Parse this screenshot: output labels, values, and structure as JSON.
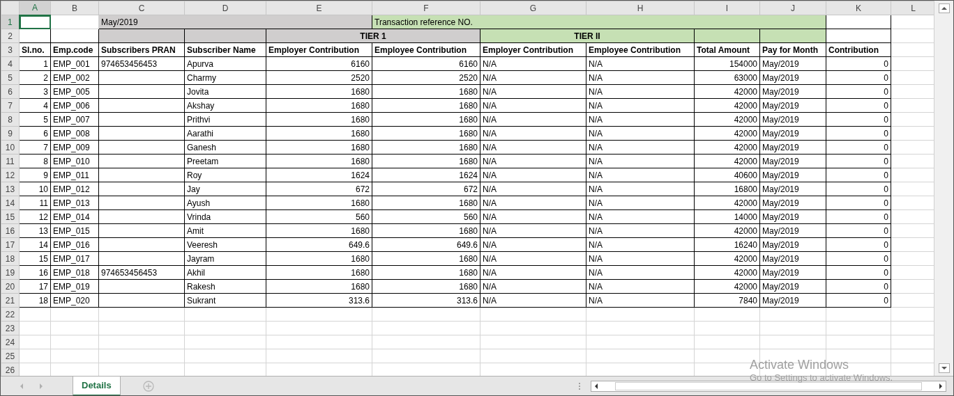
{
  "columns": [
    {
      "label": "A",
      "selected": true
    },
    {
      "label": "B",
      "selected": false
    },
    {
      "label": "C",
      "selected": false
    },
    {
      "label": "D",
      "selected": false
    },
    {
      "label": "E",
      "selected": false
    },
    {
      "label": "F",
      "selected": false
    },
    {
      "label": "G",
      "selected": false
    },
    {
      "label": "H",
      "selected": false
    },
    {
      "label": "I",
      "selected": false
    },
    {
      "label": "J",
      "selected": false
    },
    {
      "label": "K",
      "selected": false
    },
    {
      "label": "L",
      "selected": false
    }
  ],
  "row_numbers": [
    {
      "label": "1",
      "selected": true
    },
    {
      "label": "2",
      "selected": false
    },
    {
      "label": "3",
      "selected": false
    },
    {
      "label": "4",
      "selected": false
    },
    {
      "label": "5",
      "selected": false
    },
    {
      "label": "6",
      "selected": false
    },
    {
      "label": "7",
      "selected": false
    },
    {
      "label": "8",
      "selected": false
    },
    {
      "label": "9",
      "selected": false
    },
    {
      "label": "10",
      "selected": false
    },
    {
      "label": "11",
      "selected": false
    },
    {
      "label": "12",
      "selected": false
    },
    {
      "label": "13",
      "selected": false
    },
    {
      "label": "14",
      "selected": false
    },
    {
      "label": "15",
      "selected": false
    },
    {
      "label": "16",
      "selected": false
    },
    {
      "label": "17",
      "selected": false
    },
    {
      "label": "18",
      "selected": false
    },
    {
      "label": "19",
      "selected": false
    },
    {
      "label": "20",
      "selected": false
    },
    {
      "label": "21",
      "selected": false
    },
    {
      "label": "22",
      "selected": false
    },
    {
      "label": "23",
      "selected": false
    },
    {
      "label": "24",
      "selected": false
    },
    {
      "label": "25",
      "selected": false
    },
    {
      "label": "26",
      "selected": false
    }
  ],
  "header_band": {
    "date": "May/2019",
    "reference_label": "Transaction reference NO."
  },
  "tiers": [
    "TIER 1",
    "TIER II"
  ],
  "column_headers": [
    "Sl.no.",
    "Emp.code",
    "Subscribers PRAN",
    "Subscriber Name",
    "Employer Contribution",
    "Employee Contribution",
    "Employer Contribution",
    "Employee Contribution",
    "Total Amount",
    "Pay for Month",
    "Contribution"
  ],
  "rows": [
    {
      "sl": "1",
      "emp_code": "EMP_001",
      "pran": "974653456453",
      "name": "Apurva",
      "employer": "6160",
      "employee": "6160",
      "tier2_employer": "N/A",
      "tier2_employee": "N/A",
      "total": "154000",
      "month": "May/2019",
      "contribution": "0"
    },
    {
      "sl": "2",
      "emp_code": "EMP_002",
      "name": "Charmy",
      "employer": "2520",
      "employee": "2520",
      "tier2_employer": "N/A",
      "tier2_employee": "N/A",
      "total": "63000",
      "month": "May/2019",
      "contribution": "0"
    },
    {
      "sl": "3",
      "emp_code": "EMP_005",
      "name": "Jovita",
      "employer": "1680",
      "employee": "1680",
      "tier2_employer": "N/A",
      "tier2_employee": "N/A",
      "total": "42000",
      "month": "May/2019",
      "contribution": "0"
    },
    {
      "sl": "4",
      "emp_code": "EMP_006",
      "name": "Akshay",
      "employer": "1680",
      "employee": "1680",
      "tier2_employer": "N/A",
      "tier2_employee": "N/A",
      "total": "42000",
      "month": "May/2019",
      "contribution": "0"
    },
    {
      "sl": "5",
      "emp_code": "EMP_007",
      "name": "Prithvi",
      "employer": "1680",
      "employee": "1680",
      "tier2_employer": "N/A",
      "tier2_employee": "N/A",
      "total": "42000",
      "month": "May/2019",
      "contribution": "0"
    },
    {
      "sl": "6",
      "emp_code": "EMP_008",
      "name": "Aarathi",
      "employer": "1680",
      "employee": "1680",
      "tier2_employer": "N/A",
      "tier2_employee": "N/A",
      "total": "42000",
      "month": "May/2019",
      "contribution": "0"
    },
    {
      "sl": "7",
      "emp_code": "EMP_009",
      "name": "Ganesh",
      "employer": "1680",
      "employee": "1680",
      "tier2_employer": "N/A",
      "tier2_employee": "N/A",
      "total": "42000",
      "month": "May/2019",
      "contribution": "0"
    },
    {
      "sl": "8",
      "emp_code": "EMP_010",
      "name": "Preetam",
      "employer": "1680",
      "employee": "1680",
      "tier2_employer": "N/A",
      "tier2_employee": "N/A",
      "total": "42000",
      "month": "May/2019",
      "contribution": "0"
    },
    {
      "sl": "9",
      "emp_code": "EMP_011",
      "name": "Roy",
      "employer": "1624",
      "employee": "1624",
      "tier2_employer": "N/A",
      "tier2_employee": "N/A",
      "total": "40600",
      "month": "May/2019",
      "contribution": "0"
    },
    {
      "sl": "10",
      "emp_code": "EMP_012",
      "name": "Jay",
      "employer": "672",
      "employee": "672",
      "tier2_employer": "N/A",
      "tier2_employee": "N/A",
      "total": "16800",
      "month": "May/2019",
      "contribution": "0"
    },
    {
      "sl": "11",
      "emp_code": "EMP_013",
      "name": "Ayush",
      "employer": "1680",
      "employee": "1680",
      "tier2_employer": "N/A",
      "tier2_employee": "N/A",
      "total": "42000",
      "month": "May/2019",
      "contribution": "0"
    },
    {
      "sl": "12",
      "emp_code": "EMP_014",
      "name": "Vrinda",
      "employer": "560",
      "employee": "560",
      "tier2_employer": "N/A",
      "tier2_employee": "N/A",
      "total": "14000",
      "month": "May/2019",
      "contribution": "0"
    },
    {
      "sl": "13",
      "emp_code": "EMP_015",
      "name": "Amit",
      "employer": "1680",
      "employee": "1680",
      "tier2_employer": "N/A",
      "tier2_employee": "N/A",
      "total": "42000",
      "month": "May/2019",
      "contribution": "0"
    },
    {
      "sl": "14",
      "emp_code": "EMP_016",
      "name": "Veeresh",
      "employer": "649.6",
      "employee": "649.6",
      "tier2_employer": "N/A",
      "tier2_employee": "N/A",
      "total": "16240",
      "month": "May/2019",
      "contribution": "0"
    },
    {
      "sl": "15",
      "emp_code": "EMP_017",
      "name": "Jayram",
      "employer": "1680",
      "employee": "1680",
      "tier2_employer": "N/A",
      "tier2_employee": "N/A",
      "total": "42000",
      "month": "May/2019",
      "contribution": "0"
    },
    {
      "sl": "16",
      "emp_code": "EMP_018",
      "pran": "974653456453",
      "name": "Akhil",
      "employer": "1680",
      "employee": "1680",
      "tier2_employer": "N/A",
      "tier2_employee": "N/A",
      "total": "42000",
      "month": "May/2019",
      "contribution": "0"
    },
    {
      "sl": "17",
      "emp_code": "EMP_019",
      "name": "Rakesh",
      "employer": "1680",
      "employee": "1680",
      "tier2_employer": "N/A",
      "tier2_employee": "N/A",
      "total": "42000",
      "month": "May/2019",
      "contribution": "0"
    },
    {
      "sl": "18",
      "emp_code": "EMP_020",
      "name": "Sukrant",
      "employer": "313.6",
      "employee": "313.6",
      "tier2_employer": "N/A",
      "tier2_employee": "N/A",
      "total": "7840",
      "month": "May/2019",
      "contribution": "0"
    }
  ],
  "sheet_tabs": [
    {
      "label": "Details",
      "selected": true
    }
  ],
  "activation_notice": {
    "title": "Activate Windows",
    "subtitle": "Go to Settings to activate Windows."
  }
}
